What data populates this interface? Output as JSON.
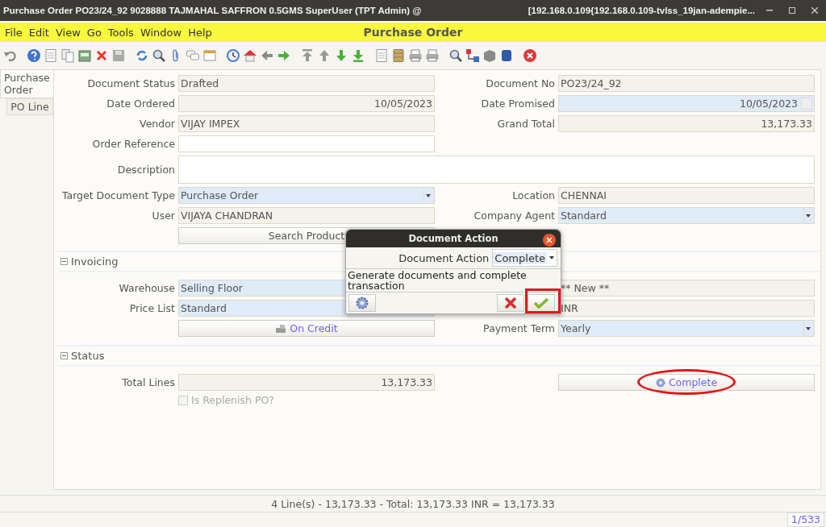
{
  "window": {
    "title": "Purchase Order  PO23/24_92  9028888  TAJMAHAL SAFFRON 0.5GMS  SuperUser (TPT Admin) @",
    "address": "[192.168.0.109{192.168.0.109-tvlss_19jan-adempie..."
  },
  "menu": [
    {
      "label": "File"
    },
    {
      "label": "Edit"
    },
    {
      "label": "View"
    },
    {
      "label": "Go"
    },
    {
      "label": "Tools"
    },
    {
      "label": "Window"
    },
    {
      "label": "Help"
    }
  ],
  "header": "Purchase Order",
  "tabs": [
    {
      "label": "Purchase Order",
      "selected": true
    },
    {
      "label": "PO Line",
      "selected": false
    }
  ],
  "form": {
    "rows": [
      {
        "left": {
          "kind": "text",
          "label": "Document Status",
          "value": "Drafted",
          "readonly": true
        },
        "right": {
          "kind": "text",
          "label": "Document No",
          "value": "PO23/24_92",
          "readonly": true
        }
      },
      {
        "left": {
          "kind": "amount",
          "label": "Date Ordered",
          "value": "10/05/2023",
          "readonly": true
        },
        "right": {
          "kind": "date",
          "label": "Date Promised",
          "value": "10/05/2023",
          "mandatory": true
        }
      },
      {
        "left": {
          "kind": "text",
          "label": "Vendor",
          "value": "VIJAY IMPEX",
          "readonly": true
        },
        "right": {
          "kind": "amount",
          "label": "Grand Total",
          "value": "13,173.33",
          "readonly": true
        }
      },
      {
        "left": {
          "kind": "text",
          "label": "Order Reference",
          "readonly": false,
          "mandatory": false
        }
      },
      {
        "wide": {
          "kind": "textarea",
          "label": "Description",
          "readonly": false,
          "mandatory": false
        }
      },
      {
        "left": {
          "kind": "combo",
          "label": "Target Document Type",
          "value": "Purchase Order",
          "mandatory": true
        },
        "right": {
          "kind": "text",
          "label": "Location",
          "value": "CHENNAI",
          "readonly": true
        }
      },
      {
        "left": {
          "kind": "text",
          "label": "User",
          "value": "VIJAYA CHANDRAN",
          "readonly": true
        },
        "right": {
          "kind": "combo",
          "label": "Company Agent",
          "value": "Standard",
          "mandatory": true
        }
      },
      {
        "left": {
          "kind": "button",
          "value": "Search Product"
        }
      }
    ],
    "sections": [
      {
        "title": "Invoicing",
        "expanded": true,
        "rows": [
          {
            "left": {
              "kind": "text",
              "label": "Warehouse",
              "value": "Selling Floor",
              "mandatory": true
            },
            "right": {
              "kind": "text",
              "value": "** New **",
              "readonly": true
            }
          },
          {
            "left": {
              "kind": "text",
              "label": "Price List",
              "value": "Standard",
              "mandatory": true
            },
            "right": {
              "kind": "text",
              "value": "INR",
              "readonly": true
            }
          },
          {
            "left": {
              "kind": "payment-button",
              "value": "On Credit"
            },
            "right": {
              "kind": "combo",
              "label": "Payment Term",
              "value": "Yearly",
              "mandatory": true
            }
          }
        ]
      },
      {
        "title": "Status",
        "expanded": true,
        "rows": [
          {
            "left": {
              "kind": "amount",
              "label": "Total Lines",
              "value": "13,173.33",
              "readonly": true
            },
            "right": {
              "kind": "process-button",
              "value": "Complete"
            }
          },
          {
            "left": {
              "kind": "checkbox",
              "value": "Is Replenish PO?",
              "checked": false,
              "disabled": true
            }
          }
        ]
      }
    ]
  },
  "dialog": {
    "title": "Document Action",
    "label": "Document Action",
    "value": "Complete",
    "description": "Generate documents and complete transaction"
  },
  "status_bar": {
    "summary": "4 Line(s) - 13,173.33 -  Total: 13,173.33  INR  =  13,173.33",
    "record": "1/533"
  }
}
